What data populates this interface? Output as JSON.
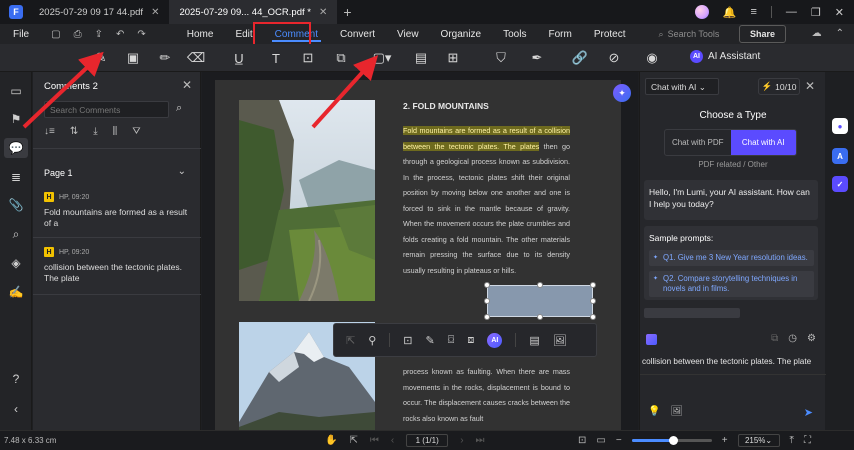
{
  "titlebar": {
    "tabs": [
      {
        "label": "2025-07-29 09 17 44.pdf"
      },
      {
        "label": "2025-07-29 09... 44_OCR.pdf *"
      }
    ]
  },
  "menubar": {
    "file_label": "File",
    "items": [
      "Home",
      "Edit",
      "Comment",
      "Convert",
      "View",
      "Organize",
      "Tools",
      "Form",
      "Protect"
    ],
    "active_item": "Comment",
    "search_placeholder": "Search Tools",
    "share_label": "Share"
  },
  "toolbar": {
    "ai_assistant_label": "AI Assistant"
  },
  "comments_panel": {
    "title": "Comments 2",
    "search_placeholder": "Search Comments",
    "page_label": "Page 1",
    "items": [
      {
        "badge": "H",
        "author": "HP",
        "time": "09:20",
        "text": "Fold mountains are formed as a result of a"
      },
      {
        "badge": "H",
        "author": "HP",
        "time": "09:20",
        "text": "collision between the tectonic plates. The plate"
      }
    ]
  },
  "document": {
    "heading": "2. FOLD MOUNTAINS",
    "highlighted_text": "Fold mountains are formed as a result of a collision between the tectonic plates. The plates",
    "body_text": " then go through a geological process known as subdivision. In the process, tectonic plates shift their original position by moving below one another and one is forced to sink in the mantle because of gravity. When the movement occurs the plate crumbles and folds creating a fold mountain. The other materials remain pressing the surface due to its density usually resulting in plateaus or hills.",
    "lower_text": "process known as faulting. When there are mass movements in the rocks, displacement is bound to occur. The displacement causes cracks between the rocks also known as fault"
  },
  "ai_panel": {
    "mode_select": "Chat with AI",
    "credits": "10/10",
    "choose_type_title": "Choose a Type",
    "type_options": [
      "Chat with PDF",
      "Chat with AI"
    ],
    "active_type": "Chat with AI",
    "type_note": "PDF related / Other",
    "greeting": "Hello, I'm Lumi, your AI assistant. How can I help you today?",
    "prompts_title": "Sample prompts:",
    "prompts": [
      "Q1. Give me 3 New Year resolution ideas.",
      "Q2. Compare storytelling techniques in novels and in films."
    ],
    "quoted_text": "collision between the tectonic plates. The plate"
  },
  "statusbar": {
    "dimensions": "7.48 x 6.33 cm",
    "page_indicator": "1 (1/1)",
    "zoom": "215%",
    "zoom_fraction": 0.52
  },
  "colors": {
    "accent": "#4b8cff",
    "highlight_box": "#e8262d",
    "ai_purple": "#5b4bff",
    "highlight_yellow": "#f2c200"
  }
}
